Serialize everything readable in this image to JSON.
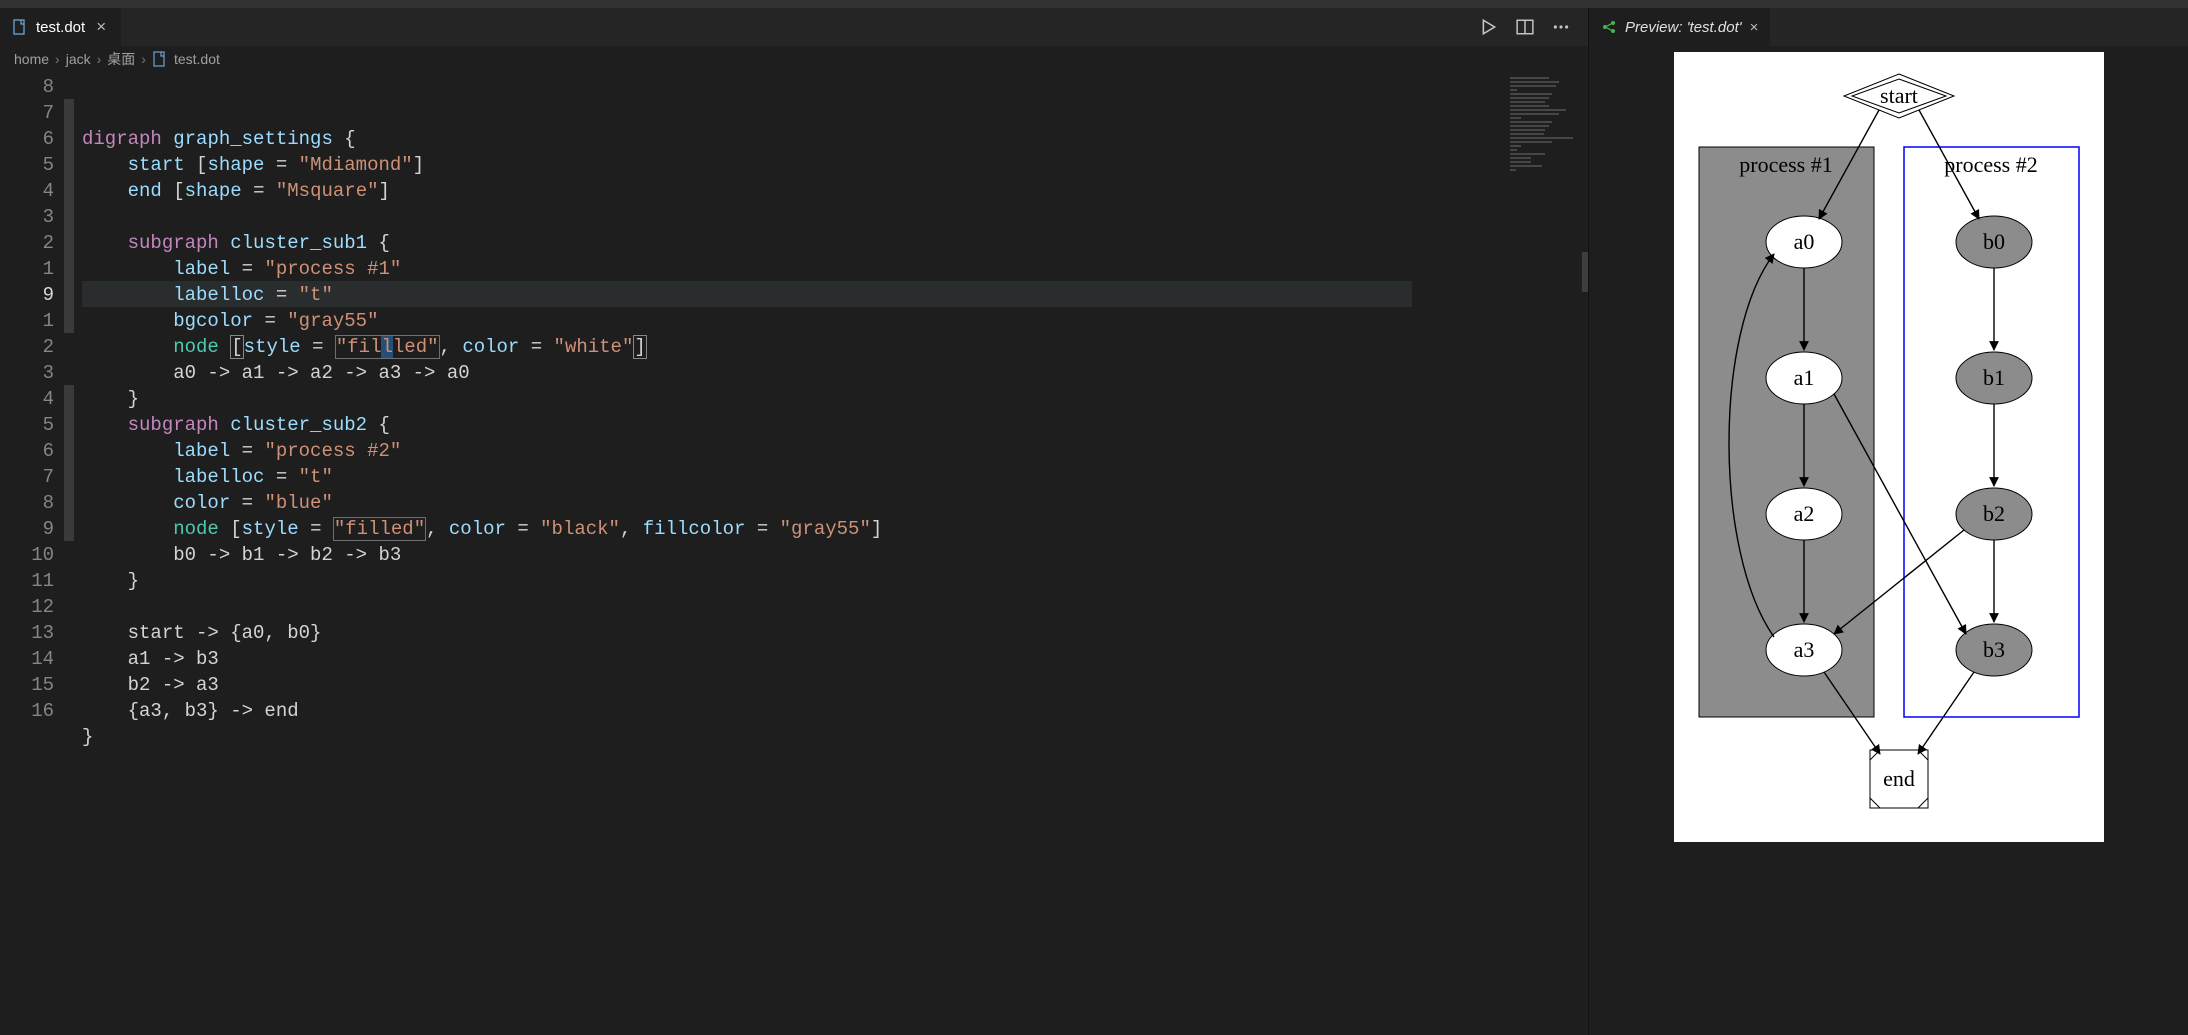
{
  "tab": {
    "filename": "test.dot"
  },
  "preview_tab": {
    "title": "Preview: 'test.dot'"
  },
  "breadcrumbs": [
    "home",
    "jack",
    "桌面",
    "test.dot"
  ],
  "gutter": [
    "8",
    "7",
    "6",
    "5",
    "4",
    "3",
    "2",
    "1",
    "9",
    "1",
    "2",
    "3",
    "4",
    "5",
    "6",
    "7",
    "8",
    "9",
    "10",
    "11",
    "12",
    "13",
    "14",
    "15",
    "16"
  ],
  "active_line_index": 8,
  "code": {
    "l1": {
      "kw": "digraph",
      "name": "graph_settings",
      "brace": "{"
    },
    "l2": {
      "id": "start",
      "lb": "[",
      "k1": "shape",
      "eq": "=",
      "v1": "\"Mdiamond\"",
      "rb": "]"
    },
    "l3": {
      "id": "end",
      "lb": "[",
      "k1": "shape",
      "eq": "=",
      "v1": "\"Msquare\"",
      "rb": "]"
    },
    "l5": {
      "kw": "subgraph",
      "name": "cluster_sub1",
      "brace": "{"
    },
    "l6": {
      "k": "label",
      "eq": "=",
      "v": "\"process #1\""
    },
    "l7": {
      "k": "labelloc",
      "eq": "=",
      "v": "\"t\""
    },
    "l8": {
      "k": "bgcolor",
      "eq": "=",
      "v": "\"gray55\""
    },
    "l9": {
      "kw": "node",
      "lb": "[",
      "k1": "style",
      "eq": "=",
      "v1a": "\"fil",
      "v1b": "led\"",
      "c": ",",
      "k2": "color",
      "v2": "\"white\"",
      "rb": "]"
    },
    "l10": {
      "body": "a0 -> a1 -> a2 -> a3 -> a0"
    },
    "l11": {
      "brace": "}"
    },
    "l12": {
      "kw": "subgraph",
      "name": "cluster_sub2",
      "brace": "{"
    },
    "l13": {
      "k": "label",
      "eq": "=",
      "v": "\"process #2\""
    },
    "l14": {
      "k": "labelloc",
      "eq": "=",
      "v": "\"t\""
    },
    "l15": {
      "k": "color",
      "eq": "=",
      "v": "\"blue\""
    },
    "l16": {
      "kw": "node",
      "lb": "[",
      "k1": "style",
      "eq": "=",
      "v1": "\"filled\"",
      "c": ",",
      "k2": "color",
      "v2": "\"black\"",
      "c2": ",",
      "k3": "fillcolor",
      "v3": "\"gray55\"",
      "rb": "]"
    },
    "l17": {
      "body": "b0 -> b1 -> b2 -> b3"
    },
    "l18": {
      "brace": "}"
    },
    "l20": {
      "body": "start -> {a0, b0}"
    },
    "l21": {
      "body": "a1 -> b3"
    },
    "l22": {
      "body": "b2 -> a3"
    },
    "l23": {
      "body": "{a3, b3} -> end"
    },
    "l24": {
      "brace": "}"
    }
  },
  "graph": {
    "start": "start",
    "end": "end",
    "cluster1": {
      "label": "process #1",
      "nodes": [
        "a0",
        "a1",
        "a2",
        "a3"
      ]
    },
    "cluster2": {
      "label": "process #2",
      "nodes": [
        "b0",
        "b1",
        "b2",
        "b3"
      ]
    }
  }
}
